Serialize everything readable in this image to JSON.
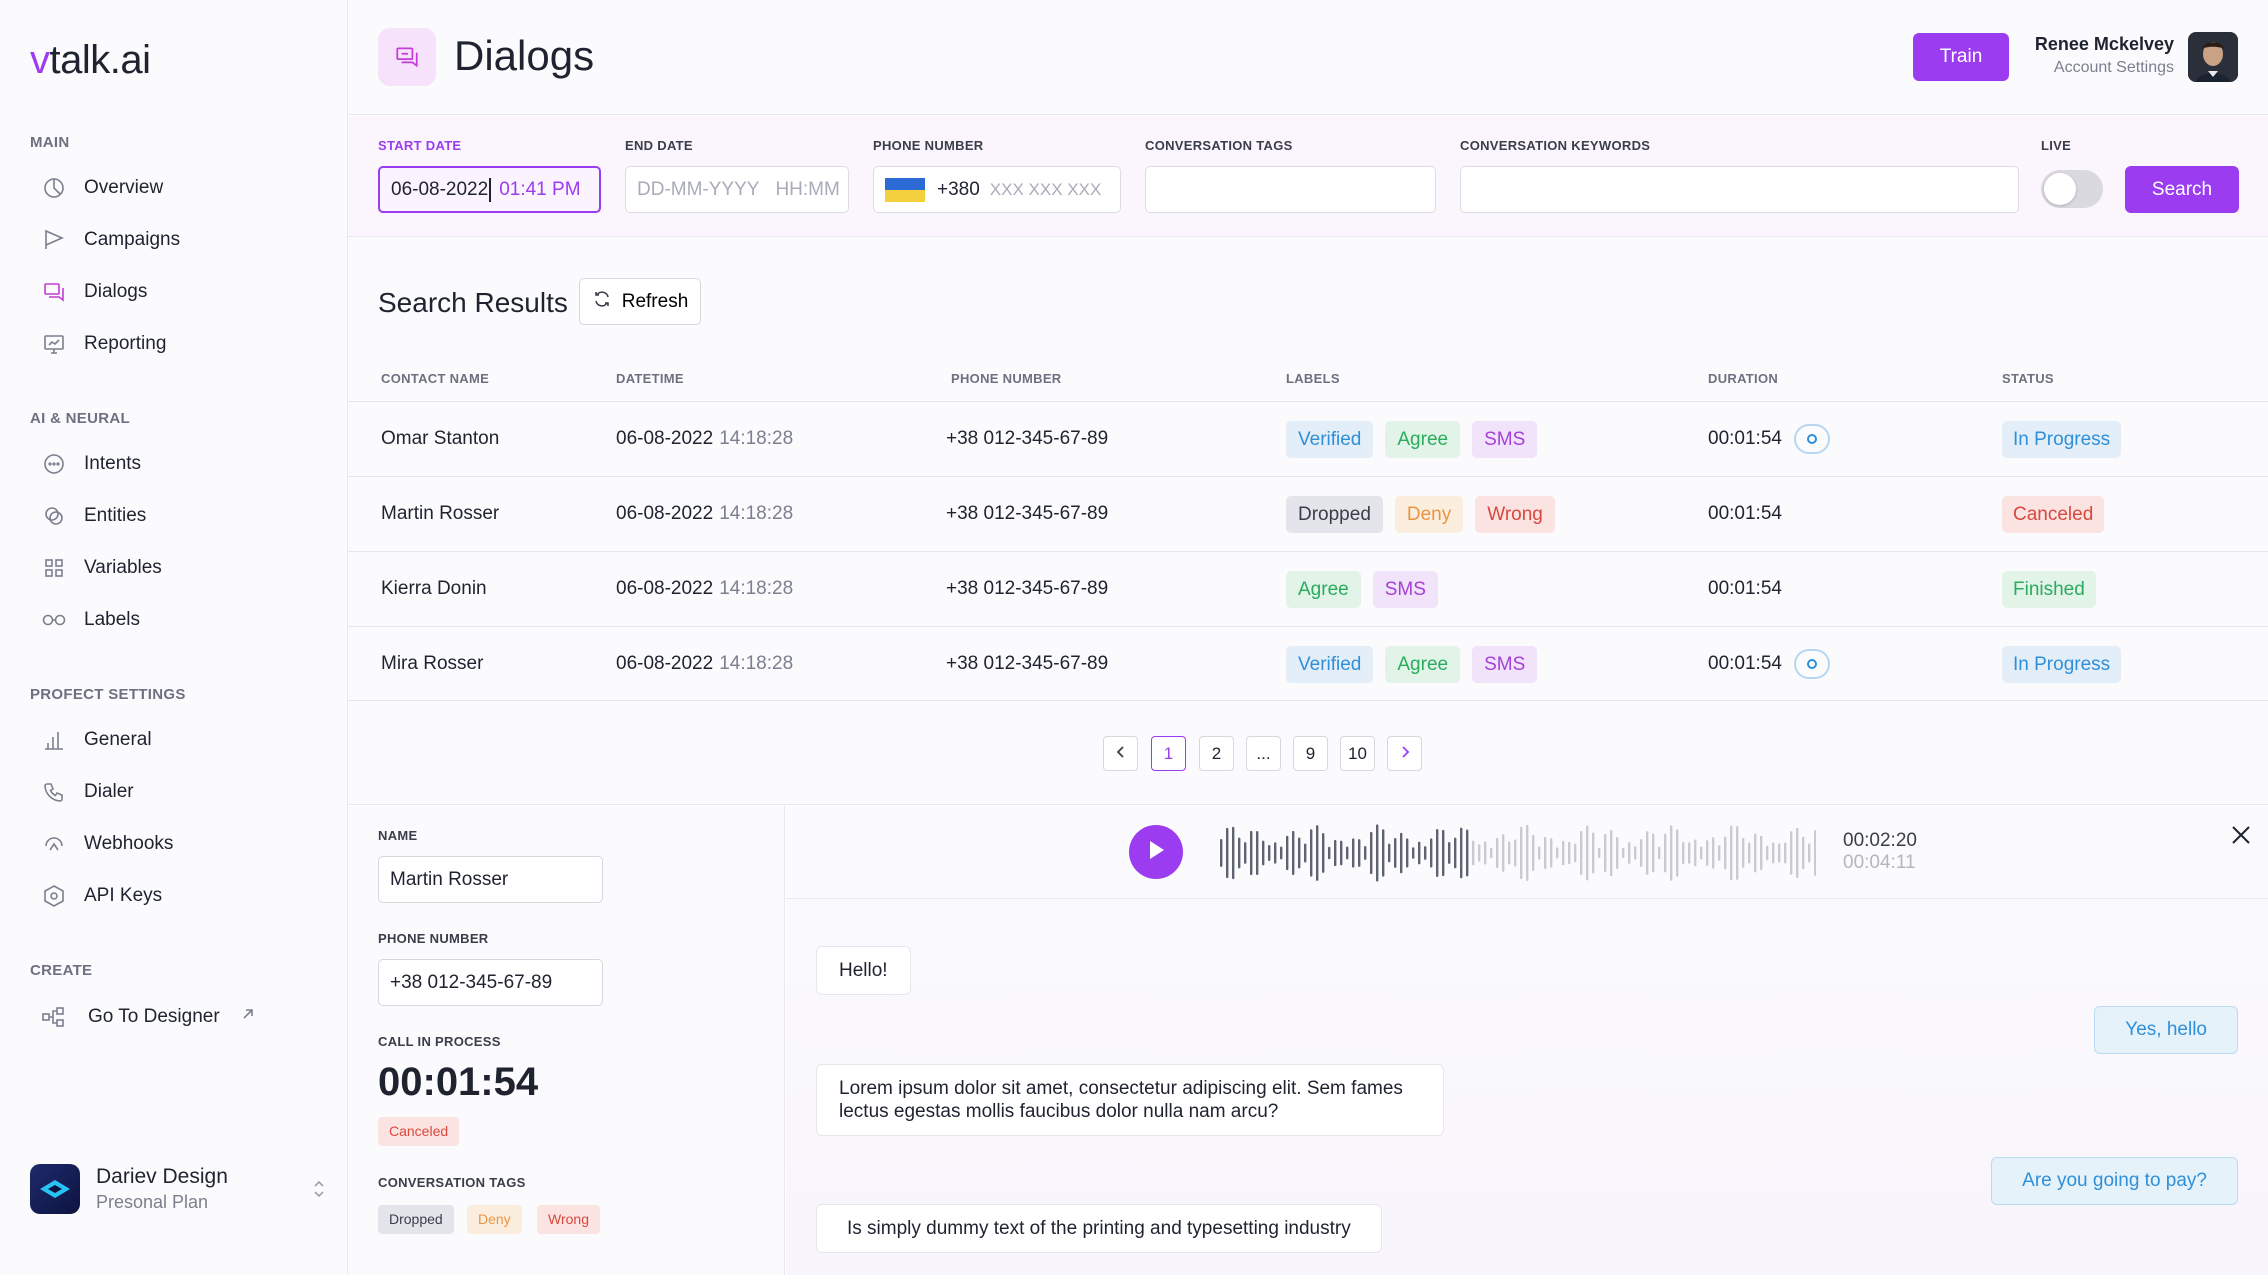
{
  "sidebar": {
    "logo_v": "v",
    "logo_text": "talk.ai",
    "sections": {
      "main": "MAIN",
      "ai": "AI & NEURAL",
      "project": "PROFECT SETTINGS",
      "create": "CREATE"
    },
    "items": {
      "overview": "Overview",
      "campaigns": "Campaigns",
      "dialogs": "Dialogs",
      "reporting": "Reporting",
      "intents": "Intents",
      "entities": "Entities",
      "variables": "Variables",
      "labels": "Labels",
      "general": "General",
      "dialer": "Dialer",
      "webhooks": "Webhooks",
      "api_keys": "API Keys",
      "designer": "Go To Designer"
    },
    "profile": {
      "name": "Dariev Design",
      "plan": "Presonal Plan"
    }
  },
  "header": {
    "title": "Dialogs",
    "train_label": "Train",
    "user_name": "Renee Mckelvey",
    "user_sub": "Account Settings"
  },
  "filters": {
    "start_date_label": "START DATE",
    "start_date": "06-08-2022",
    "start_time": "01:41 PM",
    "end_date_label": "END DATE",
    "end_date_placeholder": "DD-MM-YYYY",
    "end_time_placeholder": "HH:MM",
    "phone_label": "PHONE NUMBER",
    "phone_code": "+380",
    "phone_placeholder": "XXX XXX XXX",
    "tags_label": "CONVERSATION TAGS",
    "keywords_label": "CONVERSATION KEYWORDS",
    "live_label": "LIVE",
    "live_on": false,
    "search_label": "Search"
  },
  "results": {
    "title": "Search Results",
    "refresh_label": "Refresh",
    "columns": [
      "CONTACT NAME",
      "DATETIME",
      "PHONE NUMBER",
      "LABELS",
      "DURATION",
      "STATUS"
    ],
    "rows": [
      {
        "name": "Omar Stanton",
        "date": "06-08-2022",
        "time": "14:18:28",
        "phone": "+38 012-345-67-89",
        "labels": [
          "Verified",
          "Agree",
          "SMS"
        ],
        "duration": "00:01:54",
        "status": "In Progress"
      },
      {
        "name": "Martin Rosser",
        "date": "06-08-2022",
        "time": "14:18:28",
        "phone": "+38 012-345-67-89",
        "labels": [
          "Dropped",
          "Deny",
          "Wrong"
        ],
        "duration": "00:01:54",
        "status": "Canceled"
      },
      {
        "name": "Kierra Donin",
        "date": "06-08-2022",
        "time": "14:18:28",
        "phone": "+38 012-345-67-89",
        "labels": [
          "Agree",
          "SMS"
        ],
        "duration": "00:01:54",
        "status": "Finished"
      },
      {
        "name": "Mira Rosser",
        "date": "06-08-2022",
        "time": "14:18:28",
        "phone": "+38 012-345-67-89",
        "labels": [
          "Verified",
          "Agree",
          "SMS"
        ],
        "duration": "00:01:54",
        "status": "In Progress"
      }
    ],
    "pagination": [
      "1",
      "2",
      "...",
      "9",
      "10"
    ],
    "current_page": "1"
  },
  "detail": {
    "name_label": "NAME",
    "name": "Martin Rosser",
    "phone_label": "PHONE NUMBER",
    "phone": "+38 012-345-67-89",
    "call_label": "CALL IN PROCESS",
    "call_time": "00:01:54",
    "status": "Canceled",
    "tags_label": "CONVERSATION TAGS",
    "tags": [
      "Dropped",
      "Deny",
      "Wrong"
    ],
    "player": {
      "current": "00:02:20",
      "total": "00:04:11"
    },
    "messages": [
      {
        "from": "in",
        "text": "Hello!"
      },
      {
        "from": "out",
        "text": "Yes, hello"
      },
      {
        "from": "in",
        "text": "Lorem ipsum dolor sit amet, consectetur adipiscing elit. Sem fames lectus egestas mollis faucibus dolor nulla nam arcu?"
      },
      {
        "from": "out",
        "text": "Are you going to pay?"
      },
      {
        "from": "in",
        "text": "Is simply dummy text of the printing and typesetting industry"
      }
    ]
  },
  "colors": {
    "accent": "#9b3cf0",
    "info": "#2f8fd8",
    "success": "#2bab5e",
    "warning": "#e99542",
    "danger": "#d9483f"
  }
}
